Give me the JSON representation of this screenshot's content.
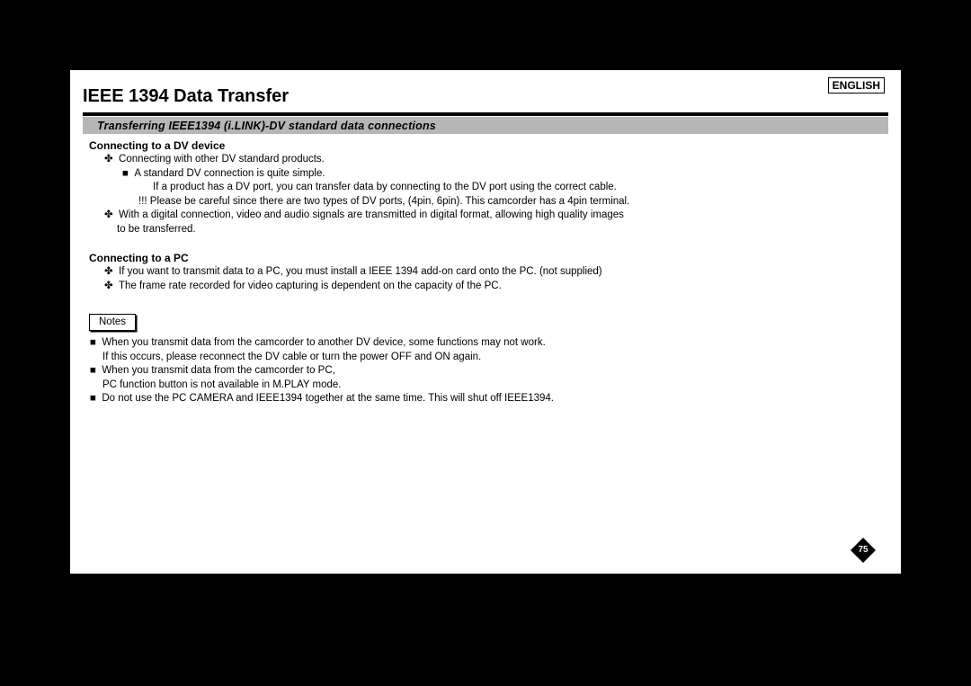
{
  "language_label": "ENGLISH",
  "title": "IEEE 1394 Data Transfer",
  "subtitle": "Transferring IEEE1394 (i.LINK)-DV standard data connections",
  "section1": {
    "heading": "Connecting to a DV device",
    "b1": "Connecting with other DV standard products.",
    "b1a": "A standard DV connection is quite simple.",
    "b1a_body": "If a product has a DV port, you can transfer data by connecting to the DV port using the correct cable.",
    "b1a_warn": "!!!   Please be careful since there are two types of DV ports, (4pin, 6pin). This camcorder has a 4pin terminal.",
    "b2": "With a digital connection, video and audio signals are transmitted in digital format, allowing high quality images",
    "b2_cont": "to be transferred."
  },
  "section2": {
    "heading": "Connecting to a PC",
    "b1": "If you want to transmit data to a PC, you must install a IEEE 1394 add-on card onto the PC. (not supplied)",
    "b2": "The frame rate recorded for video capturing is dependent on the capacity of the PC."
  },
  "notes": {
    "label": "Notes",
    "n1": "When you transmit data from the camcorder to another DV device, some functions may not work.",
    "n1_cont": "If this occurs, please reconnect the DV cable or turn the power OFF and ON again.",
    "n2": "When you transmit data from the camcorder to PC,",
    "n2_cont": "PC function button is not available in M.PLAY mode.",
    "n3": "Do not use the PC CAMERA and IEEE1394 together at the same time. This will shut off IEEE1394."
  },
  "page_number": "75",
  "glyph": {
    "maltese": "✤",
    "square": "■"
  }
}
